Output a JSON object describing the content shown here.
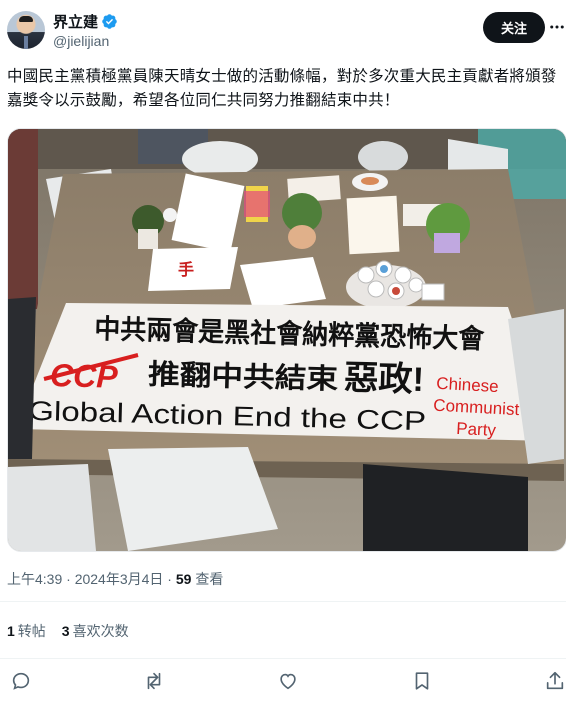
{
  "author": {
    "display_name": "界立建",
    "handle": "@jielijian",
    "follow_label": "关注"
  },
  "tweet": {
    "text": "中國民主黨積極黨員陳天晴女士做的活動條幅，對於多次重大民主貢獻者將頒發嘉獎令以示鼓勵，希望各位同仁共同努力推翻結束中共！"
  },
  "banner": {
    "line1": "中共兩會是黑社會納粹黨恐怖大會",
    "ccp_crossed": "CCP",
    "line2": "推翻中共結束",
    "line2_big": "惡政!",
    "line3": "Global Action End the CCP",
    "side_1": "Chinese",
    "side_2": "Communist",
    "side_3": "Party"
  },
  "meta": {
    "datetime": "上午4:39 · 2024年3月4日 ·",
    "views_count": "59",
    "views_label": "查看"
  },
  "stats": {
    "retweets_count": "1",
    "retweets_label": "转帖",
    "likes_count": "3",
    "likes_label": "喜欢次数"
  },
  "colors": {
    "accent": "#0f1419",
    "verified": "#1d9bf0",
    "muted": "#536471",
    "banner_red": "#d81f1f"
  }
}
